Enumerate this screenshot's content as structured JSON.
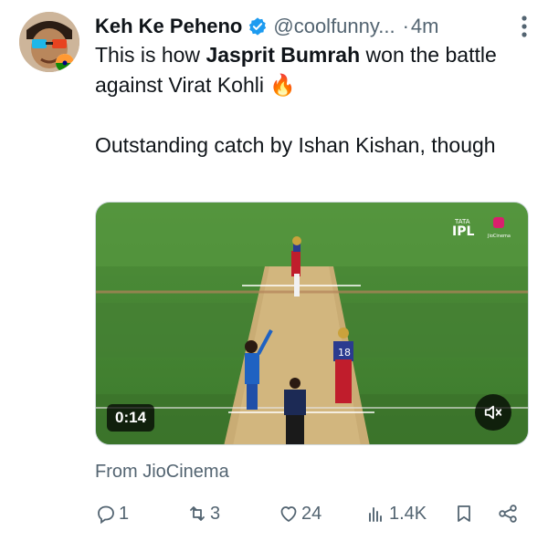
{
  "tweet": {
    "author_name": "Keh Ke Peheno",
    "handle": "@coolfunny...",
    "separator": "·",
    "time": "4m",
    "text_line1_pre": "This is how ",
    "text_line1_bold": "Jasprit Bumrah",
    "text_line1_post": " won the battle against Virat Kohli",
    "emoji": "🔥",
    "text_line2": "Outstanding catch by Ishan Kishan, though",
    "verified_color": "#1d9bf0"
  },
  "media": {
    "duration": "0:14",
    "overlay_logo": "IPL",
    "overlay_logo_small": "TATA",
    "overlay_channel": "JioCinema",
    "player_number": "18"
  },
  "source_label": "From JioCinema",
  "actions": {
    "replies": "1",
    "retweets": "3",
    "likes": "24",
    "views": "1.4K"
  },
  "colors": {
    "text": "#0f1419",
    "muted": "#536471",
    "accent": "#1d9bf0"
  }
}
